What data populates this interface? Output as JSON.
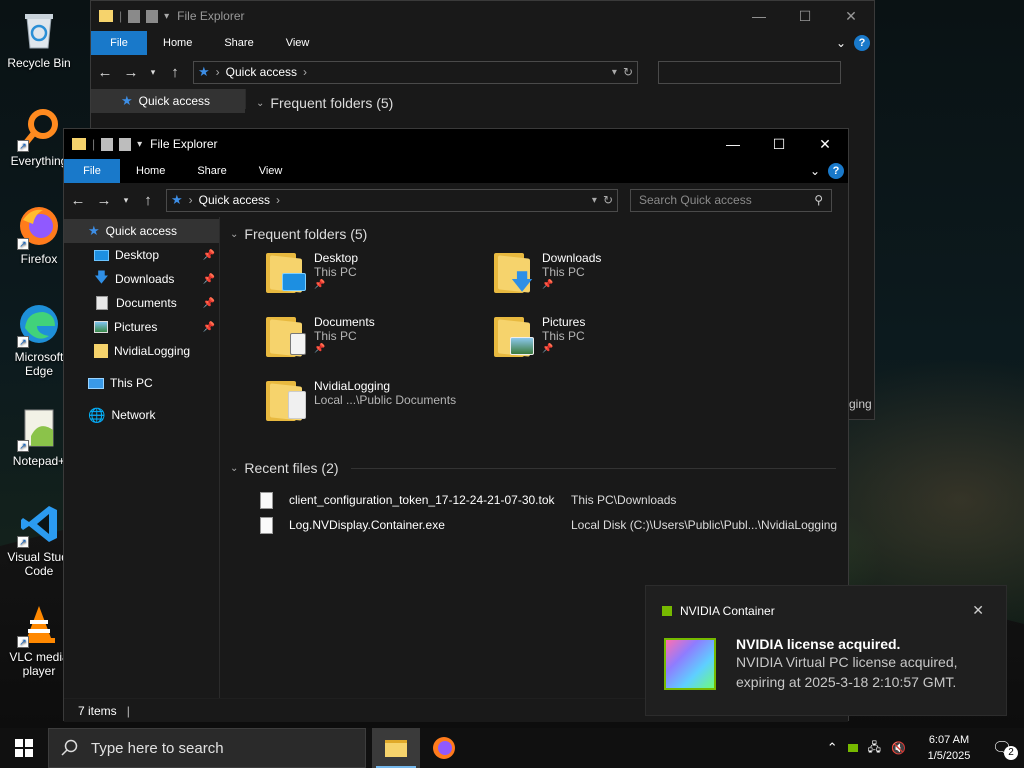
{
  "desktop": {
    "icons": [
      {
        "label": "Recycle Bin"
      },
      {
        "label": "Everything"
      },
      {
        "label": "Firefox"
      },
      {
        "label": "Microsoft Edge"
      },
      {
        "label": "Notepad+"
      },
      {
        "label": "Visual Studi Code"
      },
      {
        "label": "VLC media player"
      }
    ]
  },
  "back_window": {
    "title": "File Explorer",
    "tabs": {
      "file": "File",
      "home": "Home",
      "share": "Share",
      "view": "View"
    },
    "address": "Quick access",
    "nav_selected": "Quick access",
    "section": "Frequent folders (5)",
    "partial_text": "ging"
  },
  "front_window": {
    "title": "File Explorer",
    "tabs": {
      "file": "File",
      "home": "Home",
      "share": "Share",
      "view": "View"
    },
    "address": "Quick access",
    "search_placeholder": "Search Quick access",
    "nav": [
      {
        "label": "Quick access",
        "selected": true
      },
      {
        "label": "Desktop",
        "pinned": true
      },
      {
        "label": "Downloads",
        "pinned": true
      },
      {
        "label": "Documents",
        "pinned": true
      },
      {
        "label": "Pictures",
        "pinned": true
      },
      {
        "label": "NvidiaLogging"
      },
      {
        "label": "This PC"
      },
      {
        "label": "Network"
      }
    ],
    "frequent_header": "Frequent folders (5)",
    "folders": [
      {
        "name": "Desktop",
        "location": "This PC",
        "pinned": true
      },
      {
        "name": "Downloads",
        "location": "This PC",
        "pinned": true
      },
      {
        "name": "Documents",
        "location": "This PC",
        "pinned": true
      },
      {
        "name": "Pictures",
        "location": "This PC",
        "pinned": true
      },
      {
        "name": "NvidiaLogging",
        "location": "Local ...\\Public Documents"
      }
    ],
    "recent_header": "Recent files (2)",
    "recent_files": [
      {
        "name": "client_configuration_token_17-12-24-21-07-30.tok",
        "location": "This PC\\Downloads"
      },
      {
        "name": "Log.NVDisplay.Container.exe",
        "location": "Local Disk (C:)\\Users\\Public\\Publ...\\NvidiaLogging"
      }
    ],
    "status": "7 items"
  },
  "notification": {
    "app": "NVIDIA Container",
    "title": "NVIDIA license acquired.",
    "body": "NVIDIA Virtual PC license acquired, expiring at 2025-3-18 2:10:57 GMT."
  },
  "taskbar": {
    "search_placeholder": "Type here to search",
    "time": "6:07 AM",
    "date": "1/5/2025",
    "notification_count": "2"
  },
  "colors": {
    "accent": "#1979ca",
    "folder": "#f6d36c",
    "nvidia_green": "#76b900"
  }
}
